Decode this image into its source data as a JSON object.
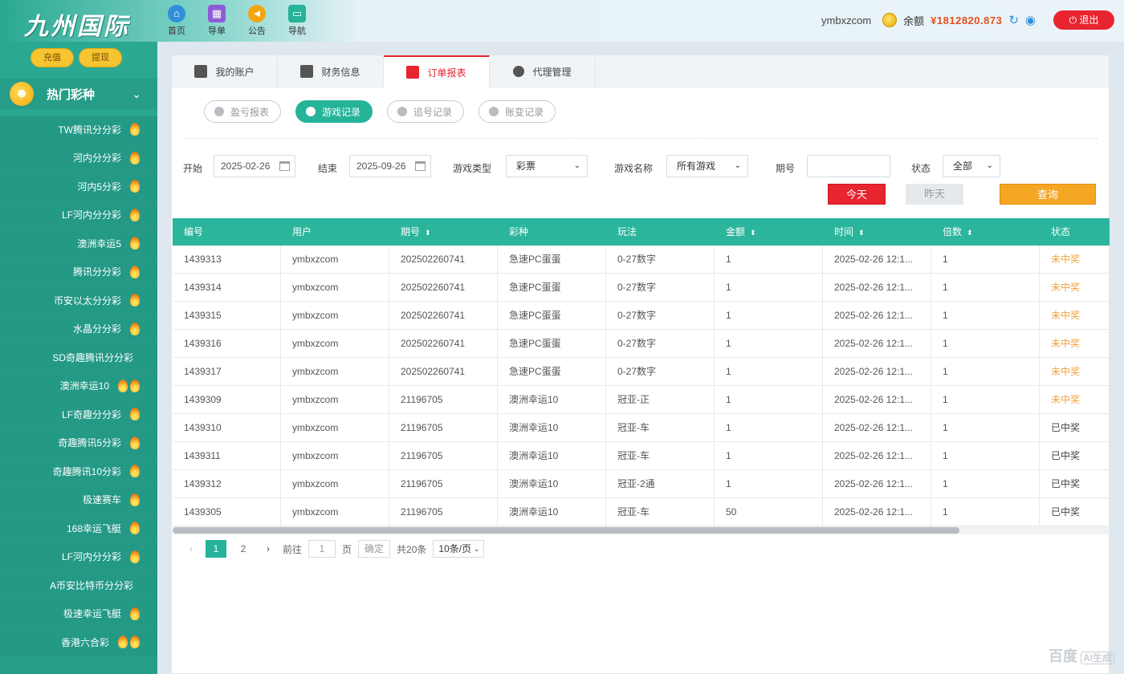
{
  "brand": {
    "logo_text": "九州国际"
  },
  "topnav": [
    {
      "label": "首页",
      "icon": "home-icon",
      "color": "#2f8fd8"
    },
    {
      "label": "导单",
      "icon": "grid-icon",
      "color": "#8e5bd8"
    },
    {
      "label": "公告",
      "icon": "megaphone-icon",
      "color": "#f2a60c"
    },
    {
      "label": "导航",
      "icon": "monitor-icon",
      "color": "#25b39a"
    }
  ],
  "header": {
    "username": "ymbxzcom",
    "balance_label": "余额",
    "balance_value": "¥1812820.873",
    "refresh_icon": "refresh-icon",
    "eye_icon": "eye-icon",
    "logout_label": "退出"
  },
  "sidebar": {
    "btn_recharge": "充值",
    "btn_withdraw": "提现",
    "group_label": "热门彩种",
    "items": [
      {
        "label": "TW腾讯分分彩",
        "flames": 1
      },
      {
        "label": "河内分分彩",
        "flames": 1
      },
      {
        "label": "河内5分彩",
        "flames": 1
      },
      {
        "label": "LF河内分分彩",
        "flames": 1
      },
      {
        "label": "澳洲幸运5",
        "flames": 1
      },
      {
        "label": "腾讯分分彩",
        "flames": 1
      },
      {
        "label": "币安以太分分彩",
        "flames": 1
      },
      {
        "label": "水晶分分彩",
        "flames": 1
      },
      {
        "label": "SD奇趣腾讯分分彩",
        "flames": 0
      },
      {
        "label": "澳洲幸运10",
        "flames": 2
      },
      {
        "label": "LF奇趣分分彩",
        "flames": 1
      },
      {
        "label": "奇趣腾讯5分彩",
        "flames": 1
      },
      {
        "label": "奇趣腾讯10分彩",
        "flames": 1
      },
      {
        "label": "极速赛车",
        "flames": 1
      },
      {
        "label": "168幸运飞艇",
        "flames": 1
      },
      {
        "label": "LF河内分分彩",
        "flames": 1
      },
      {
        "label": "A币安比特币分分彩",
        "flames": 0
      },
      {
        "label": "极速幸运飞艇",
        "flames": 1
      },
      {
        "label": "香港六合彩",
        "flames": 2
      }
    ]
  },
  "tabs": [
    {
      "label": "我的账户",
      "icon": "wallet-icon",
      "active": false
    },
    {
      "label": "财务信息",
      "icon": "finance-icon",
      "active": false
    },
    {
      "label": "订单报表",
      "icon": "report-icon",
      "active": true
    },
    {
      "label": "代理管理",
      "icon": "agent-icon",
      "active": false
    }
  ],
  "subtabs": [
    {
      "label": "盈亏报表",
      "active": false
    },
    {
      "label": "游戏记录",
      "active": true
    },
    {
      "label": "追号记录",
      "active": false
    },
    {
      "label": "账变记录",
      "active": false
    }
  ],
  "filters": {
    "start_label": "开始",
    "start_value": "2025-02-26",
    "end_label": "结束",
    "end_value": "2025-09-26",
    "type_label": "游戏类型",
    "type_value": "彩票",
    "name_label": "游戏名称",
    "name_value": "所有游戏",
    "issue_label": "期号",
    "issue_value": "",
    "status_label": "状态",
    "status_value": "全部",
    "btn_today": "今天",
    "btn_yesterday": "昨天",
    "btn_query": "查询"
  },
  "table": {
    "headers": [
      {
        "label": "编号",
        "sort": false
      },
      {
        "label": "用户",
        "sort": false
      },
      {
        "label": "期号",
        "sort": true
      },
      {
        "label": "彩种",
        "sort": false
      },
      {
        "label": "玩法",
        "sort": false
      },
      {
        "label": "金额",
        "sort": true
      },
      {
        "label": "时间",
        "sort": true
      },
      {
        "label": "倍数",
        "sort": true
      },
      {
        "label": "状态",
        "sort": false
      }
    ],
    "rows": [
      [
        "1439313",
        "ymbxzcom",
        "202502260741",
        "急速PC蛋蛋",
        "0-27数字",
        "1",
        "2025-02-26 12:1...",
        "1",
        "未中奖"
      ],
      [
        "1439314",
        "ymbxzcom",
        "202502260741",
        "急速PC蛋蛋",
        "0-27数字",
        "1",
        "2025-02-26 12:1...",
        "1",
        "未中奖"
      ],
      [
        "1439315",
        "ymbxzcom",
        "202502260741",
        "急速PC蛋蛋",
        "0-27数字",
        "1",
        "2025-02-26 12:1...",
        "1",
        "未中奖"
      ],
      [
        "1439316",
        "ymbxzcom",
        "202502260741",
        "急速PC蛋蛋",
        "0-27数字",
        "1",
        "2025-02-26 12:1...",
        "1",
        "未中奖"
      ],
      [
        "1439317",
        "ymbxzcom",
        "202502260741",
        "急速PC蛋蛋",
        "0-27数字",
        "1",
        "2025-02-26 12:1...",
        "1",
        "未中奖"
      ],
      [
        "1439309",
        "ymbxzcom",
        "21196705",
        "澳洲幸运10",
        "冠亚-正",
        "1",
        "2025-02-26 12:1...",
        "1",
        "未中奖"
      ],
      [
        "1439310",
        "ymbxzcom",
        "21196705",
        "澳洲幸运10",
        "冠亚-车",
        "1",
        "2025-02-26 12:1...",
        "1",
        "已中奖"
      ],
      [
        "1439311",
        "ymbxzcom",
        "21196705",
        "澳洲幸运10",
        "冠亚-车",
        "1",
        "2025-02-26 12:1...",
        "1",
        "已中奖"
      ],
      [
        "1439312",
        "ymbxzcom",
        "21196705",
        "澳洲幸运10",
        "冠亚-2通",
        "1",
        "2025-02-26 12:1...",
        "1",
        "已中奖"
      ],
      [
        "1439305",
        "ymbxzcom",
        "21196705",
        "澳洲幸运10",
        "冠亚-车",
        "50",
        "2025-02-26 12:1...",
        "1",
        "已中奖"
      ]
    ]
  },
  "pagination": {
    "pages": [
      "1",
      "2"
    ],
    "current": "1",
    "goto_label": "前往",
    "goto_value": "1",
    "page_unit": "页",
    "confirm_label": "确定",
    "total_label": "共20条",
    "page_size": "10条/页"
  },
  "watermark": {
    "text": "百度",
    "ai_label": "AI生成"
  },
  "colors": {
    "brand_green": "#2bb59c",
    "accent_red": "#e8242f",
    "accent_orange": "#f5a623",
    "lose_text": "#f0a33a"
  }
}
